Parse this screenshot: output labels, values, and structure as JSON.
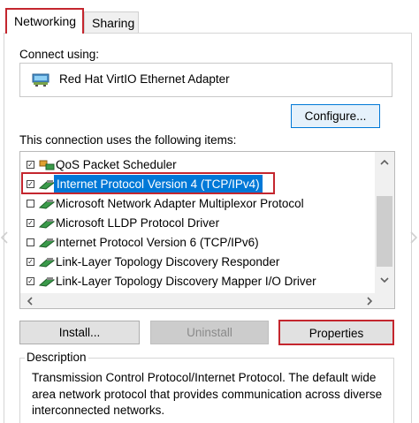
{
  "tabs": [
    {
      "label": "Networking",
      "active": true
    },
    {
      "label": "Sharing",
      "active": false
    }
  ],
  "connect_using_label": "Connect using:",
  "adapter": {
    "name": "Red Hat VirtIO Ethernet Adapter",
    "icon": "network-adapter-icon"
  },
  "configure_label": "Configure...",
  "items_label": "This connection uses the following items:",
  "items": [
    {
      "label": "QoS Packet Scheduler",
      "checked": true,
      "icon": "scheduler-icon"
    },
    {
      "label": "Internet Protocol Version 4 (TCP/IPv4)",
      "checked": true,
      "selected": true,
      "icon": "protocol-icon"
    },
    {
      "label": "Microsoft Network Adapter Multiplexor Protocol",
      "checked": false,
      "icon": "protocol-icon"
    },
    {
      "label": "Microsoft LLDP Protocol Driver",
      "checked": true,
      "icon": "protocol-icon"
    },
    {
      "label": "Internet Protocol Version 6 (TCP/IPv6)",
      "checked": false,
      "icon": "protocol-icon"
    },
    {
      "label": "Link-Layer Topology Discovery Responder",
      "checked": true,
      "icon": "protocol-icon"
    },
    {
      "label": "Link-Layer Topology Discovery Mapper I/O Driver",
      "checked": true,
      "icon": "protocol-icon"
    }
  ],
  "buttons": {
    "install": "Install...",
    "uninstall": "Uninstall",
    "properties": "Properties"
  },
  "description": {
    "label": "Description",
    "text": "Transmission Control Protocol/Internet Protocol. The default wide area network protocol that provides communication across diverse interconnected networks."
  },
  "colors": {
    "selection": "#0078d7",
    "highlight_outline": "#c4262e"
  }
}
